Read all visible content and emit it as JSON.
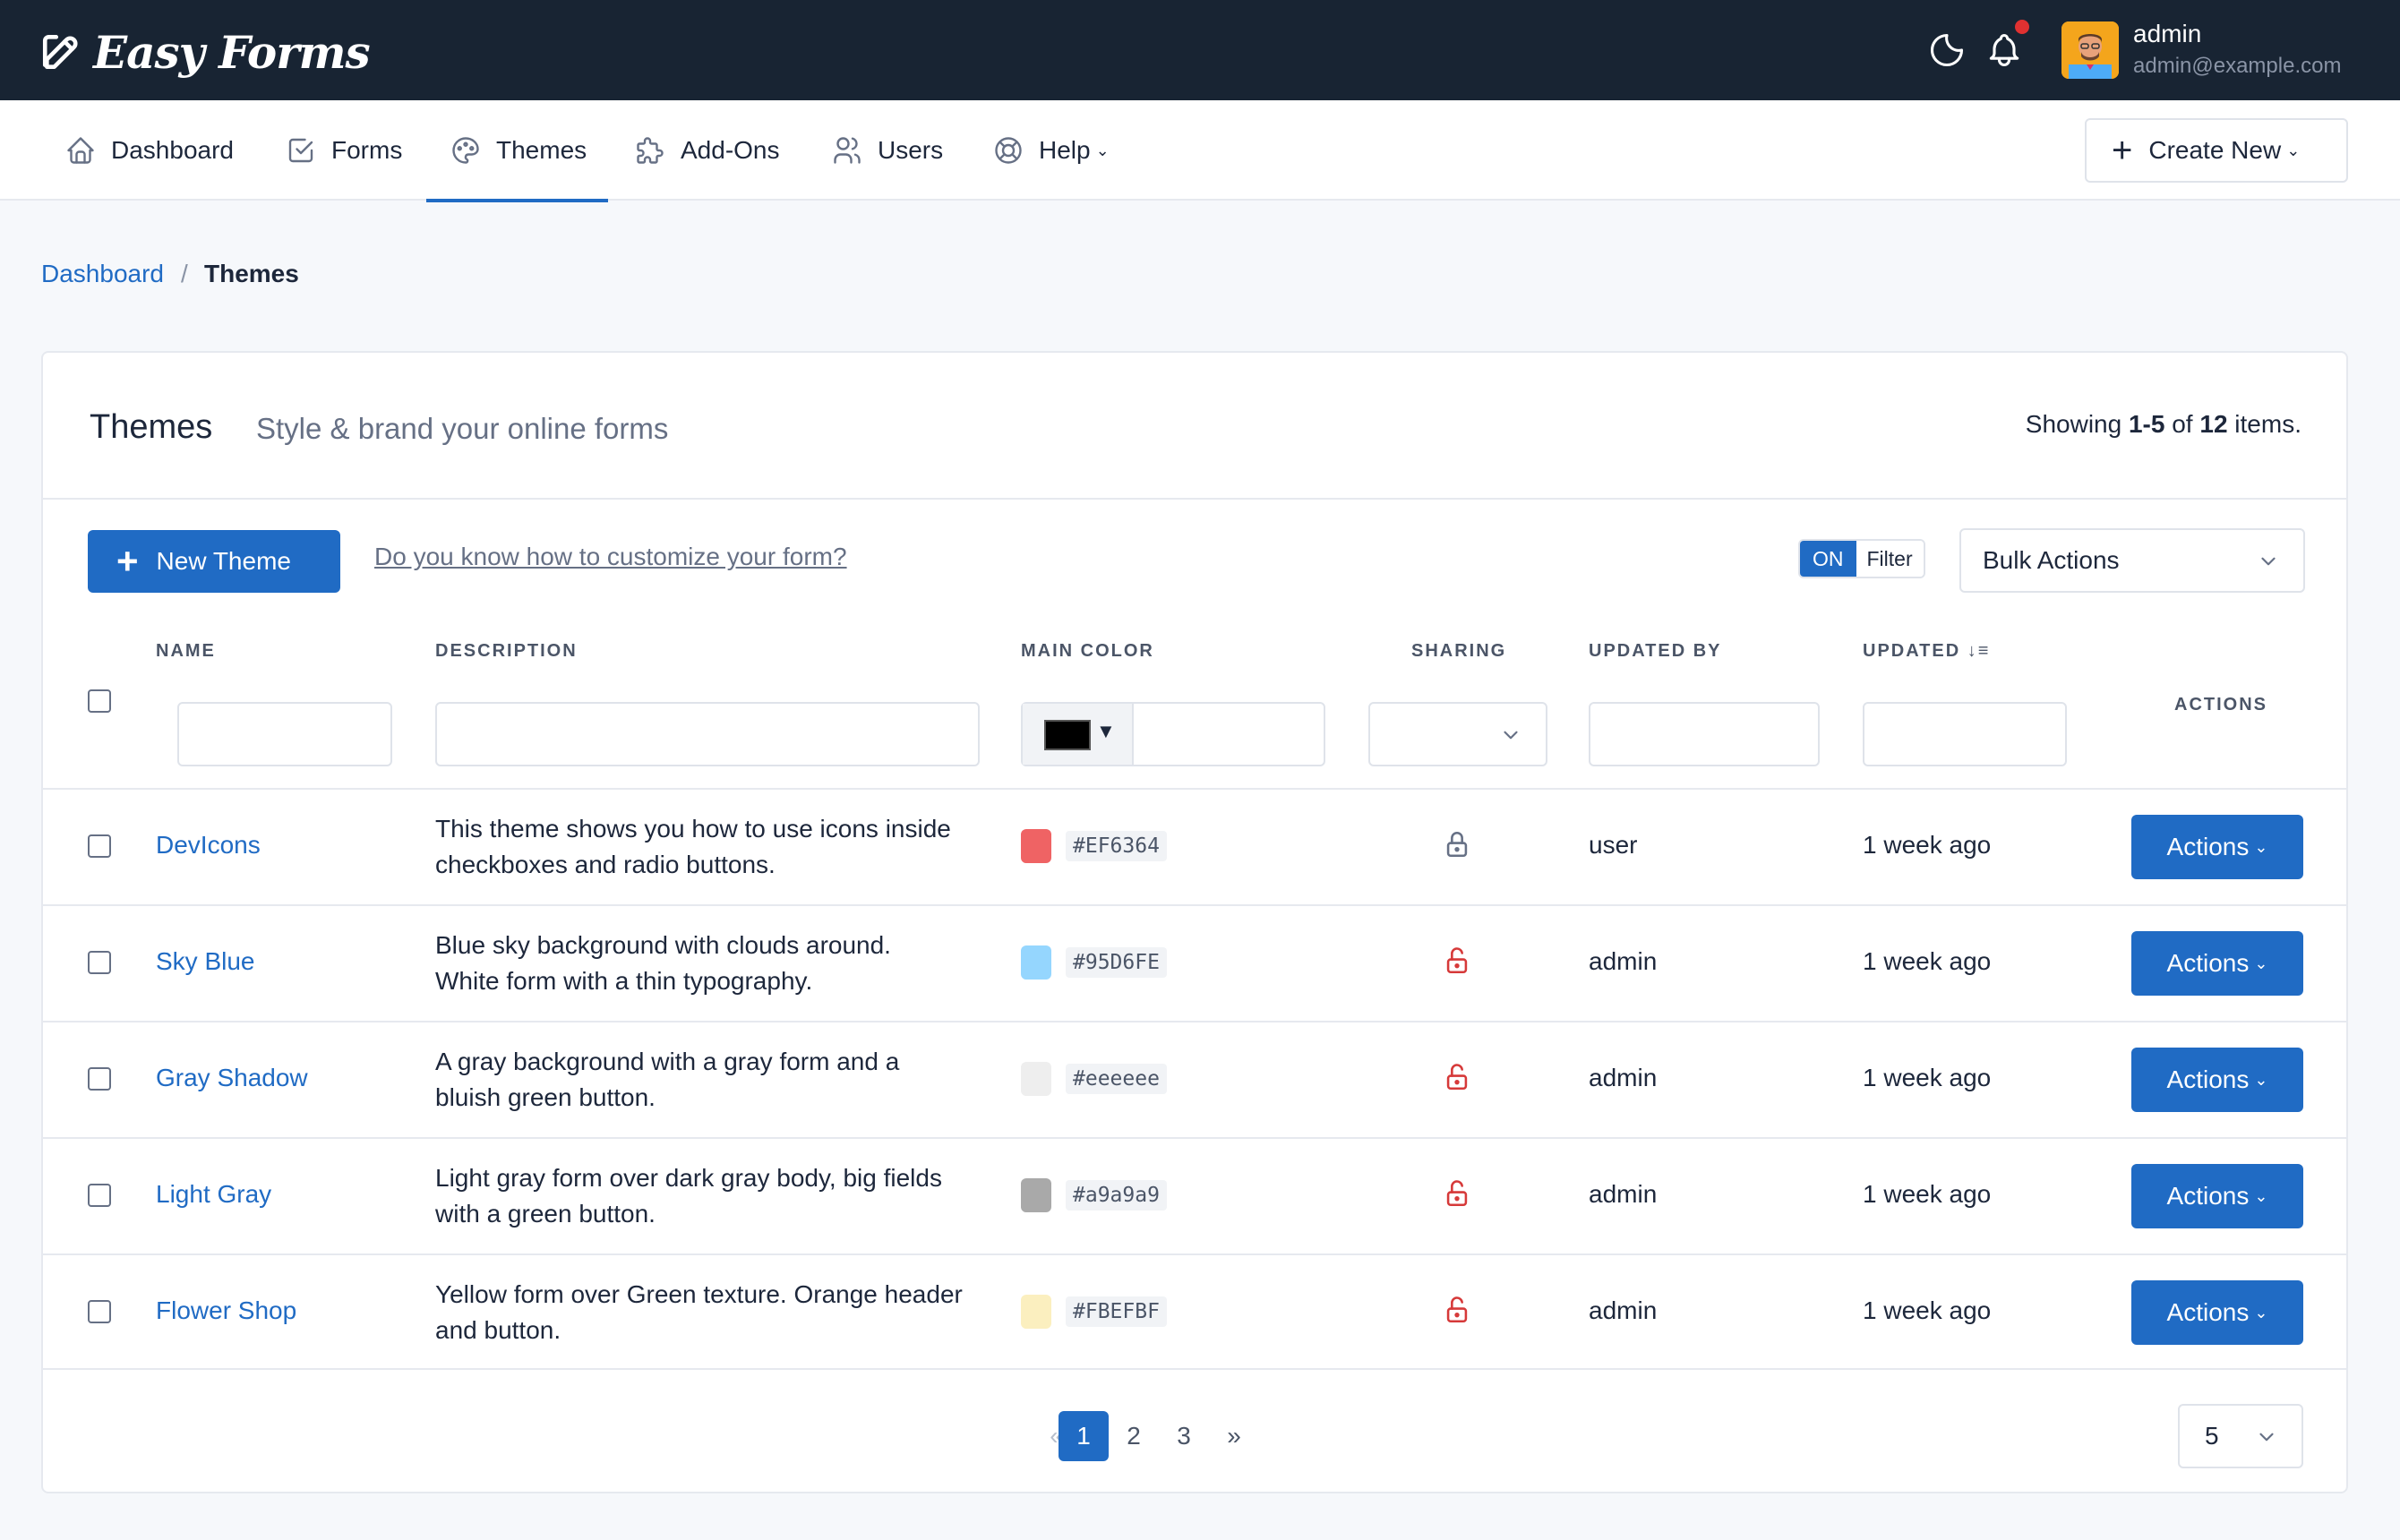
{
  "app": {
    "brand": "Easy Forms"
  },
  "user": {
    "name": "admin",
    "email": "admin@example.com"
  },
  "nav": {
    "items": [
      {
        "label": "Dashboard",
        "icon": "home-icon"
      },
      {
        "label": "Forms",
        "icon": "checkbox-icon"
      },
      {
        "label": "Themes",
        "icon": "palette-icon",
        "active": true
      },
      {
        "label": "Add-Ons",
        "icon": "puzzle-icon"
      },
      {
        "label": "Users",
        "icon": "users-icon"
      },
      {
        "label": "Help",
        "icon": "lifebuoy-icon"
      }
    ],
    "create_new": "Create New"
  },
  "breadcrumb": {
    "link": "Dashboard",
    "separator": "/",
    "current": "Themes"
  },
  "card": {
    "title": "Themes",
    "subtitle": "Style & brand your online forms",
    "showing_prefix": "Showing ",
    "showing_range": "1-5",
    "showing_of": " of ",
    "showing_total": "12",
    "showing_suffix": " items."
  },
  "toolbar": {
    "new_theme": "New Theme",
    "help_link": "Do you know how to customize your form?",
    "filter_on": "ON",
    "filter_label": "Filter",
    "bulk_actions": "Bulk Actions"
  },
  "columns": {
    "name": "NAME",
    "description": "DESCRIPTION",
    "main_color": "MAIN COLOR",
    "sharing": "SHARING",
    "updated_by": "UPDATED BY",
    "updated": "UPDATED",
    "actions": "ACTIONS"
  },
  "rows": [
    {
      "name": "DevIcons",
      "desc1": "This theme shows you how to use icons inside",
      "desc2": "checkboxes and radio buttons.",
      "color": "#EF6364",
      "locked": true,
      "updated_by": "user",
      "updated": "1 week ago",
      "action": "Actions"
    },
    {
      "name": "Sky Blue",
      "desc1": "Blue sky background with clouds around.",
      "desc2": "White form with a thin typography.",
      "color": "#95D6FE",
      "locked": false,
      "updated_by": "admin",
      "updated": "1 week ago",
      "action": "Actions"
    },
    {
      "name": "Gray Shadow",
      "desc1": "A gray background with a gray form and a",
      "desc2": "bluish green button.",
      "color": "#eeeeee",
      "locked": false,
      "updated_by": "admin",
      "updated": "1 week ago",
      "action": "Actions"
    },
    {
      "name": "Light Gray",
      "desc1": "Light gray form over dark gray body, big fields",
      "desc2": "with a green button.",
      "color": "#a9a9a9",
      "locked": false,
      "updated_by": "admin",
      "updated": "1 week ago",
      "action": "Actions"
    },
    {
      "name": "Flower Shop",
      "desc1": "Yellow form over Green texture. Orange header",
      "desc2": "and button.",
      "color": "#FBEFBF",
      "locked": false,
      "updated_by": "admin",
      "updated": "1 week ago",
      "action": "Actions"
    }
  ],
  "pagination": {
    "prev": "«",
    "pages": [
      "1",
      "2",
      "3"
    ],
    "next": "»",
    "current": "1",
    "per_page": "5"
  },
  "colors": {
    "accent": "#206bc4",
    "topbar": "#182433",
    "unlocked": "#d63939",
    "locked": "#667085"
  }
}
